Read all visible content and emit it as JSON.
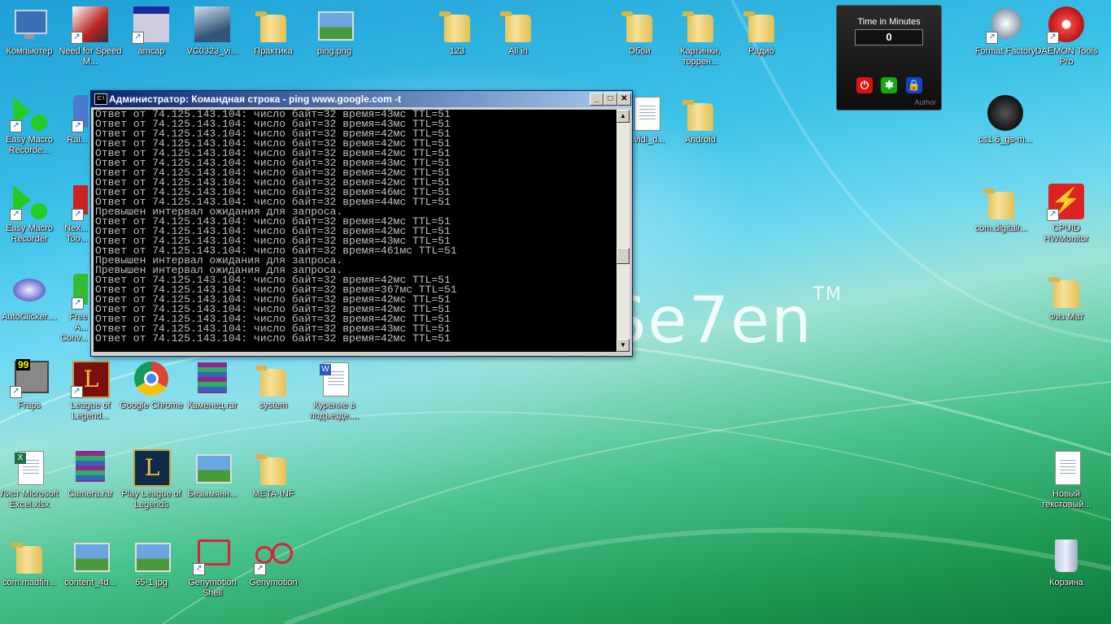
{
  "desktop_icons": [
    {
      "label": "Компьютер",
      "icon": "computer-icon"
    },
    {
      "label": "Need for Speed M...",
      "icon": "nfs-game-icon"
    },
    {
      "label": "amcap",
      "icon": "amcap-icon"
    },
    {
      "label": "VC0323_vi...",
      "icon": "vc0323-icon"
    },
    {
      "label": "Практика",
      "icon": "folder-icon"
    },
    {
      "label": "ping.png",
      "icon": "image-file-icon"
    },
    {
      "label": "123",
      "icon": "folder-icon"
    },
    {
      "label": "All in",
      "icon": "folder-icon"
    },
    {
      "label": "Обои",
      "icon": "folder-icon"
    },
    {
      "label": "Картинки, торрен...",
      "icon": "folder-icon"
    },
    {
      "label": "Радио",
      "icon": "folder-icon"
    },
    {
      "label": "Format Factory",
      "icon": "format-factory-icon"
    },
    {
      "label": "DAEMON Tools Pro",
      "icon": "daemon-tools-icon"
    },
    {
      "label": "Easy Macro Recorde...",
      "icon": "easy-macro-icon"
    },
    {
      "label": "Rai...",
      "icon": "app-icon"
    },
    {
      "label": "...vidi_d...",
      "icon": "document-icon"
    },
    {
      "label": "Android",
      "icon": "folder-icon"
    },
    {
      "label": "cs1.6_gs-m...",
      "icon": "counter-strike-icon"
    },
    {
      "label": "Easy Macro Recorder",
      "icon": "easy-macro-icon"
    },
    {
      "label": "Nex... Too...",
      "icon": "app-icon"
    },
    {
      "label": "com.digitalr...",
      "icon": "folder-icon"
    },
    {
      "label": "CPUID HWMonitor",
      "icon": "hwmonitor-icon"
    },
    {
      "label": "AutoClicker....",
      "icon": "autoclicker-icon"
    },
    {
      "label": "Free A... Conv...",
      "icon": "app-icon"
    },
    {
      "label": "Физ Мат",
      "icon": "folder-icon"
    },
    {
      "label": "Fraps",
      "icon": "fraps-icon"
    },
    {
      "label": "League of Legend...",
      "icon": "lol-icon"
    },
    {
      "label": "Google Chrome",
      "icon": "chrome-icon"
    },
    {
      "label": "Каменец.rar",
      "icon": "rar-icon"
    },
    {
      "label": "system",
      "icon": "folder-icon"
    },
    {
      "label": "Курение в подъезде....",
      "icon": "word-doc-icon"
    },
    {
      "label": "Лист Microsoft Excel.xlsx",
      "icon": "excel-icon"
    },
    {
      "label": "Camera.rar",
      "icon": "rar-icon"
    },
    {
      "label": "Play League of Legends",
      "icon": "lol-icon"
    },
    {
      "label": "Безымянн...",
      "icon": "image-file-icon"
    },
    {
      "label": "META-INF",
      "icon": "folder-icon"
    },
    {
      "label": "Новый текстовый...",
      "icon": "text-file-icon"
    },
    {
      "label": "com.madfin...",
      "icon": "folder-icon"
    },
    {
      "label": "content_4d...",
      "icon": "image-file-icon"
    },
    {
      "label": "65-1.jpg",
      "icon": "image-file-icon"
    },
    {
      "label": "Genymotion Shell",
      "icon": "genymotion-shell-icon"
    },
    {
      "label": "Genymotion",
      "icon": "genymotion-icon"
    },
    {
      "label": "Корзина",
      "icon": "recycle-bin-icon"
    }
  ],
  "wallpaper_text": "Se7en",
  "wallpaper_tm": "TM",
  "gadget": {
    "title": "Time in Minutes",
    "value": "0",
    "author": "Author"
  },
  "console": {
    "title": "Администратор: Командная строка - ping  www.google.com -t",
    "icon_text": "C:\\",
    "buttons": {
      "minimize": "_",
      "maximize": "□",
      "close": "✕"
    },
    "lines": [
      "Ответ от 74.125.143.104: число байт=32 время=43мс TTL=51",
      "Ответ от 74.125.143.104: число байт=32 время=43мс TTL=51",
      "Ответ от 74.125.143.104: число байт=32 время=42мс TTL=51",
      "Ответ от 74.125.143.104: число байт=32 время=42мс TTL=51",
      "Ответ от 74.125.143.104: число байт=32 время=42мс TTL=51",
      "Ответ от 74.125.143.104: число байт=32 время=43мс TTL=51",
      "Ответ от 74.125.143.104: число байт=32 время=42мс TTL=51",
      "Ответ от 74.125.143.104: число байт=32 время=42мс TTL=51",
      "Ответ от 74.125.143.104: число байт=32 время=46мс TTL=51",
      "Ответ от 74.125.143.104: число байт=32 время=44мс TTL=51",
      "Превышен интервал ожидания для запроса.",
      "Ответ от 74.125.143.104: число байт=32 время=42мс TTL=51",
      "Ответ от 74.125.143.104: число байт=32 время=42мс TTL=51",
      "Ответ от 74.125.143.104: число байт=32 время=43мс TTL=51",
      "Ответ от 74.125.143.104: число байт=32 время=461мс TTL=51",
      "Превышен интервал ожидания для запроса.",
      "Превышен интервал ожидания для запроса.",
      "Ответ от 74.125.143.104: число байт=32 время=42мс TTL=51",
      "Ответ от 74.125.143.104: число байт=32 время=367мс TTL=51",
      "Ответ от 74.125.143.104: число байт=32 время=42мс TTL=51",
      "Ответ от 74.125.143.104: число байт=32 время=42мс TTL=51",
      "Ответ от 74.125.143.104: число байт=32 время=42мс TTL=51",
      "Ответ от 74.125.143.104: число байт=32 время=43мс TTL=51",
      "Ответ от 74.125.143.104: число байт=32 время=42мс TTL=51"
    ]
  }
}
